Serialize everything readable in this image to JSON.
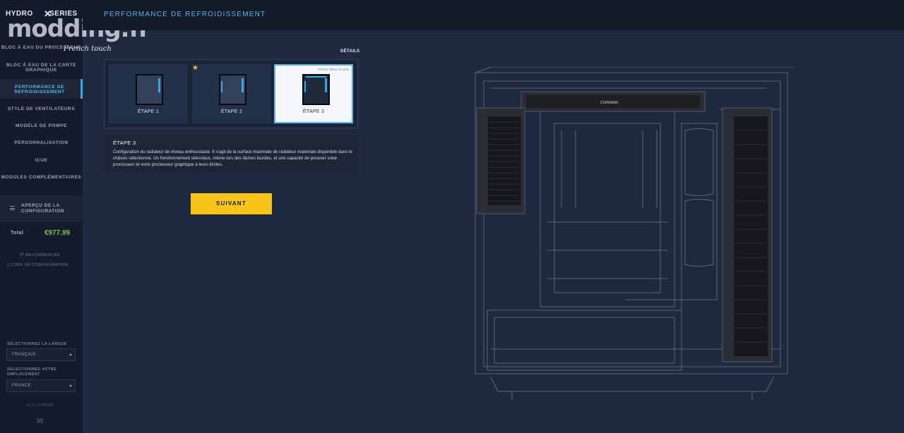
{
  "brand": {
    "logo_text": "HYDRO",
    "logo_text_2": "SERIES",
    "watermark": "modding.fr",
    "tagline": "French touch"
  },
  "sidebar": {
    "items": [
      {
        "label": "BLOC À EAU DU PROCESSEUR",
        "active": false
      },
      {
        "label": "BLOC À EAU DE LA CARTE GRAPHIQUE",
        "active": false
      },
      {
        "label": "PERFORMANCE DE REFROIDISSEMENT",
        "active": true
      },
      {
        "label": "STYLE DE VENTILATEURS",
        "active": false
      },
      {
        "label": "MODÈLE DE POMPE",
        "active": false
      },
      {
        "label": "PERSONNALISATION",
        "active": false
      },
      {
        "label": "ICUE",
        "active": false
      },
      {
        "label": "MODULES COMPLÉMENTAIRES",
        "active": false
      }
    ],
    "summary_label": "APERÇU DE LA CONFIGURATION",
    "total_label": "Total",
    "total_price": "€977.99",
    "restart_label": "RECOMMENCER",
    "config_code_label": "CODE DE CONFIGURATION",
    "language_label": "SÉLECTIONNEZ LA LANGUE",
    "language_value": "FRANÇAIS",
    "location_label": "SÉLECTIONNEZ VOTRE EMPLACEMENT",
    "location_value": "FRANCE",
    "version": "v1.3 | CHX192",
    "footer_logo": "W"
  },
  "header": {
    "title": "PERFORMANCE DE REFROIDISSEMENT"
  },
  "main": {
    "details_label": "DÉTAILS",
    "steps": [
      {
        "label": "ÉTAPE 1",
        "selected": false,
        "recommended": false
      },
      {
        "label": "ÉTAPE 2",
        "selected": false,
        "recommended": true
      },
      {
        "label": "ÉTAPE 3",
        "selected": true,
        "recommended": false,
        "badge": "Inclus dans le prix"
      }
    ],
    "description": {
      "title": "ÉTAPE 3",
      "text": "Configuration du radiateur de niveau enthousiaste. Il s'agit de la surface maximale de radiateur maximale disponible dans le châssis sélectionné. Un fonctionnement silencieux, même lors des tâches lourdes, et une capacité de pousser votre processeur et votre processeur graphique à leurs limites."
    },
    "next_label": "SUIVANT"
  },
  "render": {
    "brand_text": "CORSAIR"
  },
  "colors": {
    "accent_blue": "#5bb6f0",
    "accent_yellow": "#f8c51b",
    "price_green": "#7fc241",
    "background": "#1f2940"
  }
}
